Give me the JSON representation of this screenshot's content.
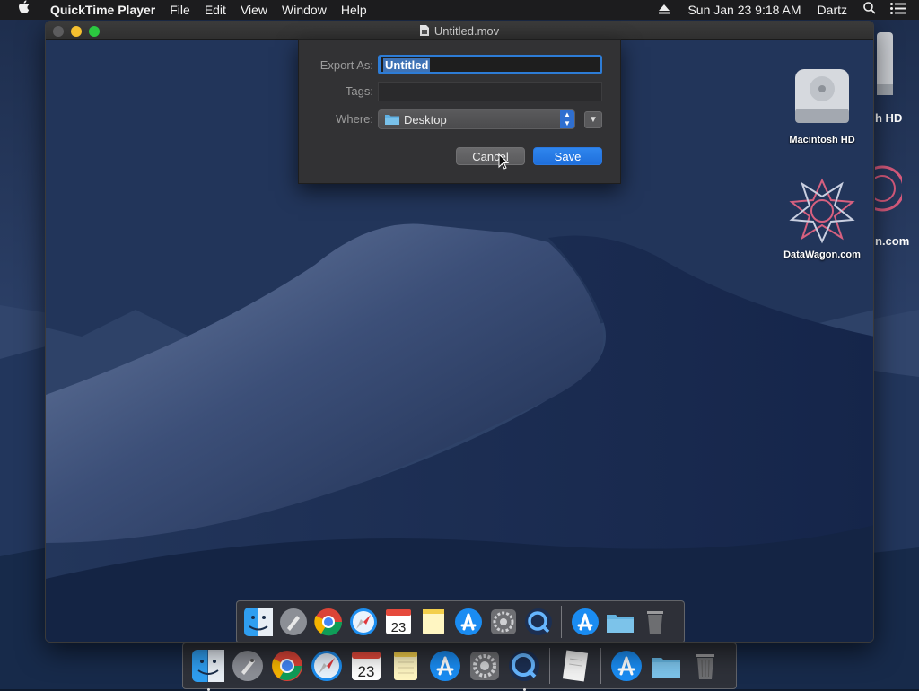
{
  "menubar": {
    "apple_icon": "apple-logo",
    "app_name": "QuickTime Player",
    "menus": [
      "File",
      "Edit",
      "View",
      "Window",
      "Help"
    ],
    "datetime": "Sun Jan 23  9:18 AM",
    "user": "Dartz"
  },
  "window": {
    "title": "Untitled.mov"
  },
  "export_dialog": {
    "export_as_label": "Export As:",
    "export_as_value": "Untitled",
    "tags_label": "Tags:",
    "tags_value": "",
    "where_label": "Where:",
    "where_value": "Desktop",
    "cancel_label": "Cancel",
    "save_label": "Save"
  },
  "desktop_icons": [
    {
      "label": "Macintosh HD",
      "icon": "hard-drive-icon"
    },
    {
      "label": "DataWagon.com",
      "icon": "datawagon-icon"
    }
  ],
  "desktop_icons_behind": [
    {
      "label": "h HD"
    },
    {
      "label": "n.com"
    }
  ],
  "dock_inner": {
    "apps": [
      "Finder",
      "Launchpad",
      "Chrome",
      "Safari",
      "Calendar",
      "Notes",
      "App Store",
      "System Preferences",
      "QuickTime Player"
    ],
    "calendar_date": "23",
    "extras": [
      "App Store Downloads",
      "Documents Folder",
      "Trash"
    ]
  },
  "dock_outer": {
    "apps": [
      "Finder",
      "Launchpad",
      "Chrome",
      "Safari",
      "Calendar",
      "Notes",
      "App Store",
      "System Preferences",
      "QuickTime Player"
    ],
    "calendar_date": "23",
    "extras": [
      "Preview Document",
      "App Store Downloads",
      "Documents Folder",
      "Trash"
    ]
  },
  "colors": {
    "accent": "#2f7ce6",
    "menubar_bg": "#1c1c1e",
    "dialog_bg": "#323234"
  }
}
